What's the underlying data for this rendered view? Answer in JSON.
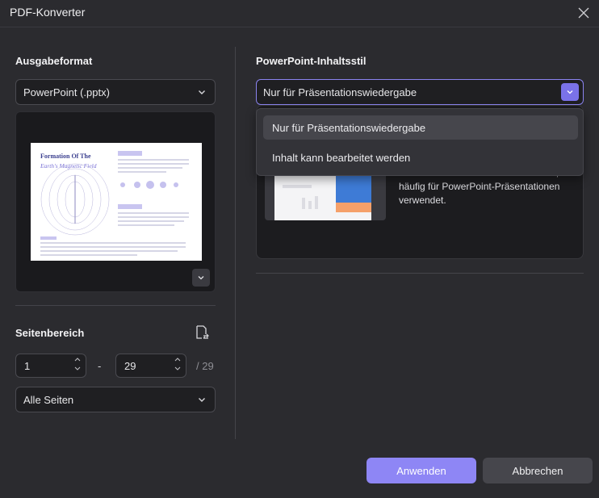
{
  "window": {
    "title": "PDF-Konverter"
  },
  "output_format": {
    "heading": "Ausgabeformat",
    "selected": "PowerPoint (.pptx)",
    "preview": {
      "title_line1": "Formation Of The",
      "title_line2": "Earth's Magnetic Field"
    }
  },
  "page_range": {
    "heading": "Seitenbereich",
    "from": "1",
    "separator": "-",
    "to": "29",
    "total": "/ 29",
    "pages_select": "Alle Seiten"
  },
  "content_style": {
    "heading": "PowerPoint-Inhaltsstil",
    "selected": "Nur für Präsentationswiedergabe",
    "options": [
      "Nur für Präsentationswiedergabe",
      "Inhalt kann bearbeitet werden"
    ],
    "description_partial": "des Dokuments besser zu bewahren, häufig für PowerPoint-Präsentationen verwendet."
  },
  "actions": {
    "apply": "Anwenden",
    "cancel": "Abbrechen"
  },
  "colors": {
    "accent": "#8e86f5",
    "background": "#2b2b2f"
  }
}
